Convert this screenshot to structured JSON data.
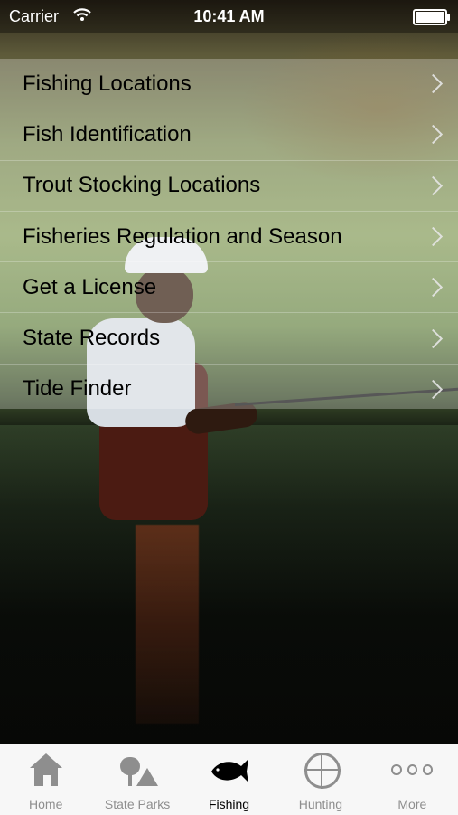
{
  "status_bar": {
    "carrier": "Carrier",
    "time": "10:41 AM"
  },
  "menu": {
    "items": [
      {
        "label": "Fishing Locations"
      },
      {
        "label": "Fish Identification"
      },
      {
        "label": "Trout Stocking Locations"
      },
      {
        "label": "Fisheries Regulation and Season"
      },
      {
        "label": "Get a License"
      },
      {
        "label": "State Records"
      },
      {
        "label": "Tide Finder"
      }
    ]
  },
  "tab_bar": {
    "tabs": [
      {
        "label": "Home",
        "icon": "home-icon"
      },
      {
        "label": "State Parks",
        "icon": "tree-tent-icon"
      },
      {
        "label": "Fishing",
        "icon": "fish-icon",
        "active": true
      },
      {
        "label": "Hunting",
        "icon": "deer-target-icon"
      },
      {
        "label": "More",
        "icon": "ellipsis-icon"
      }
    ]
  },
  "colors": {
    "tab_inactive": "#8e8e8e",
    "tab_active": "#000000",
    "tabbar_bg": "#f7f7f7"
  }
}
